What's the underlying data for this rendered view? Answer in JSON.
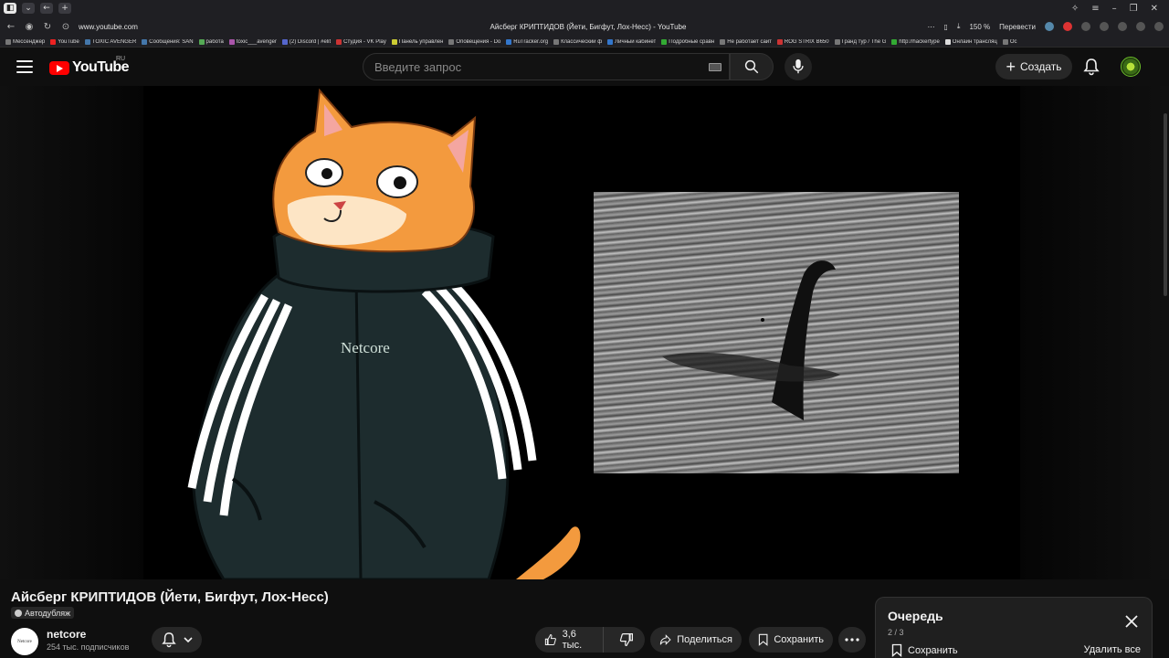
{
  "browser": {
    "url": "www.youtube.com",
    "page_title": "Айсберг КРИПТИДОВ (Йети, Бигфут, Лох-Несс) - YouTube",
    "zoom": "150 %",
    "translate": "Перевести",
    "bookmarks": [
      "Мессенджер",
      "YouTube",
      "TOXIC AVENGER",
      "Сообщения: SAN",
      "работа",
      "toxic___avenger",
      "(2) Discord | #elit",
      "Студия - VK Play",
      "Панель управлен",
      "Оповещения - Do",
      "RuTracker.org",
      "Классический ф",
      "Личный кабинет",
      "Подробные сравн",
      "Не работает сайт",
      "ROG STRIX B650",
      "Гранд тур / The G",
      "http://hackertype",
      "Онлайн трансляц",
      "Ос"
    ]
  },
  "header": {
    "logo_text": "YouTube",
    "region": "RU",
    "search_placeholder": "Введите запрос",
    "create_label": "Создать"
  },
  "video": {
    "title": "Айсберг КРИПТИДОВ (Йети, Бигфут, Лох-Несс)",
    "autodub": "Автодубляж",
    "jacket_logo": "Netcore"
  },
  "channel": {
    "name": "netcore",
    "subscribers": "254 тыс. подписчиков",
    "avatar_text": "Netcore"
  },
  "actions": {
    "likes": "3,6 тыс.",
    "share": "Поделиться",
    "save": "Сохранить"
  },
  "queue": {
    "title": "Очередь",
    "count": "2 / 3",
    "save": "Сохранить",
    "clear": "Удалить все"
  }
}
